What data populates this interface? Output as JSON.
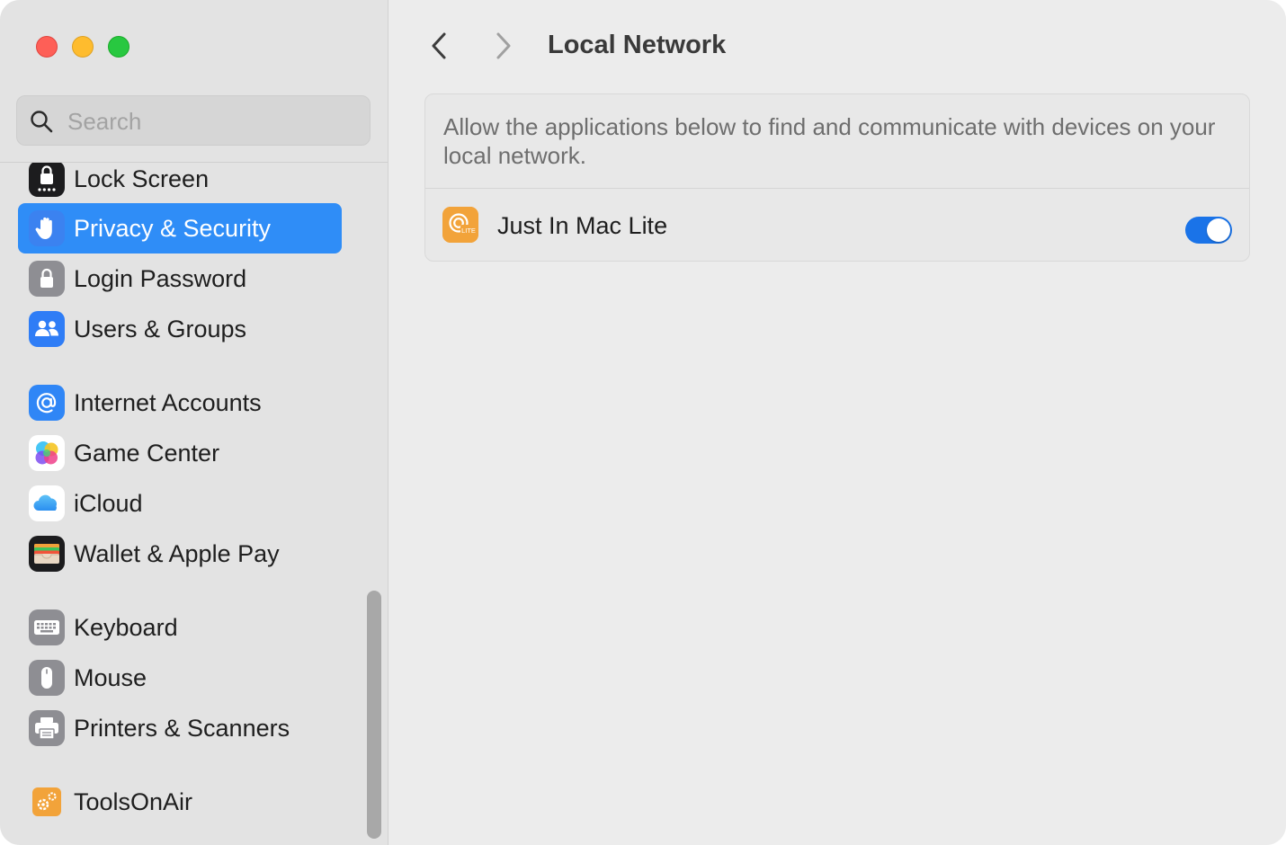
{
  "window": {
    "controls": [
      "close",
      "minimize",
      "maximize"
    ]
  },
  "sidebar": {
    "search": {
      "placeholder": "Search",
      "value": "",
      "icon": "search-icon"
    },
    "items": [
      {
        "label": "Lock Screen",
        "icon": "lock-screen-icon",
        "selected": false
      },
      {
        "label": "Privacy & Security",
        "icon": "hand-icon",
        "selected": true
      },
      {
        "label": "Login Password",
        "icon": "lock-icon",
        "selected": false
      },
      {
        "label": "Users & Groups",
        "icon": "users-icon",
        "selected": false
      },
      {
        "label": "Internet Accounts",
        "icon": "at-sign-icon",
        "selected": false
      },
      {
        "label": "Game Center",
        "icon": "game-center-icon",
        "selected": false
      },
      {
        "label": "iCloud",
        "icon": "cloud-icon",
        "selected": false
      },
      {
        "label": "Wallet & Apple Pay",
        "icon": "wallet-icon",
        "selected": false
      },
      {
        "label": "Keyboard",
        "icon": "keyboard-icon",
        "selected": false
      },
      {
        "label": "Mouse",
        "icon": "mouse-icon",
        "selected": false
      },
      {
        "label": "Printers & Scanners",
        "icon": "printer-icon",
        "selected": false
      },
      {
        "label": "ToolsOnAir",
        "icon": "gears-icon",
        "selected": false
      }
    ]
  },
  "header": {
    "title": "Local Network",
    "back_icon": "chevron-left-icon",
    "forward_icon": "chevron-right-icon"
  },
  "main": {
    "description": "Allow the applications below to find and communicate with devices on your local network.",
    "apps": [
      {
        "name": "Just In Mac Lite",
        "icon": "just-in-mac-lite-icon",
        "badge": "LITE",
        "enabled": true
      }
    ]
  },
  "colors": {
    "accent": "#2f8df7",
    "toggle_on": "#1a73e8",
    "app_icon_orange": "#f2a33a"
  }
}
